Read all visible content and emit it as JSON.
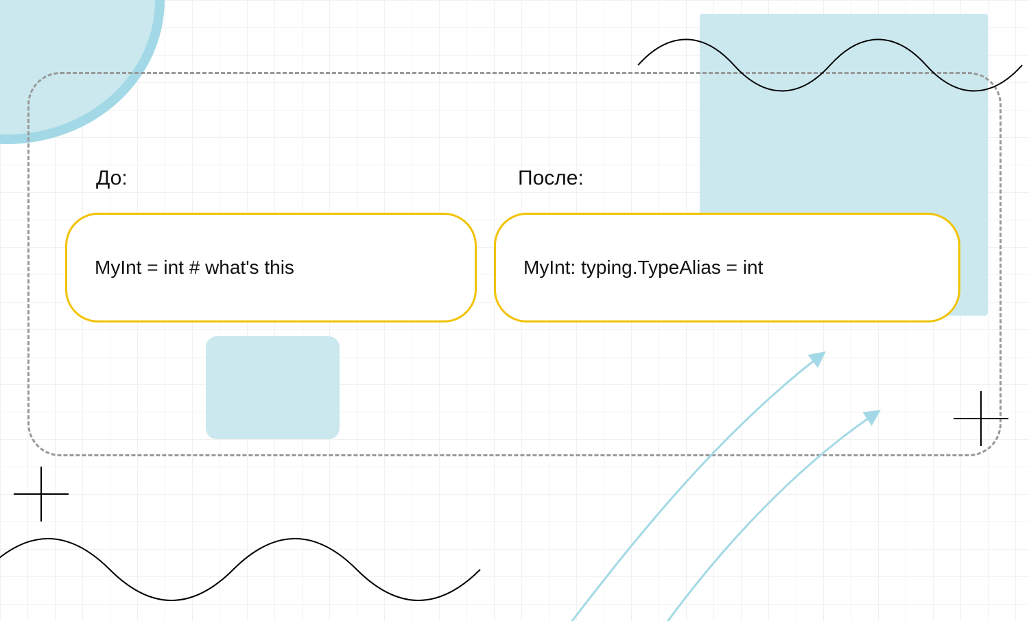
{
  "labels": {
    "before": "До:",
    "after": "После:"
  },
  "code": {
    "before": "MyInt = int  # what's this",
    "after": "MyInt: typing.TypeAlias = int"
  },
  "colors": {
    "accent_yellow": "#f2c200",
    "accent_cyan": "#cbe8ee",
    "accent_cyan_stroke": "#a3d9e6",
    "grid": "#e8e8e8"
  }
}
